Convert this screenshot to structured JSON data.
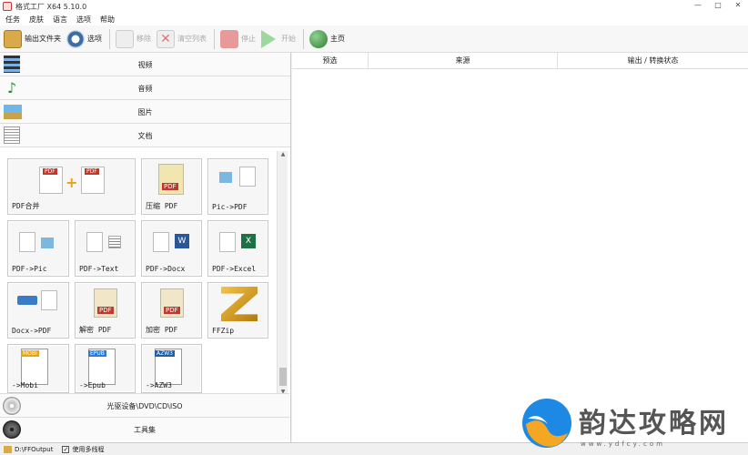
{
  "window": {
    "title": "格式工厂 X64 5.10.0",
    "controls": [
      "—",
      "□",
      "✕"
    ]
  },
  "menu": [
    "任务",
    "皮肤",
    "语言",
    "选项",
    "帮助"
  ],
  "toolbar": {
    "output_folder": "输出文件夹",
    "options": "选项",
    "remove": "移除",
    "clear_list": "清空列表",
    "stop": "停止",
    "start": "开始",
    "home": "主页"
  },
  "categories": {
    "video": "视频",
    "audio": "音频",
    "picture": "图片",
    "document": "文档"
  },
  "tools": [
    {
      "label": "PDF合并"
    },
    {
      "label": "压缩 PDF"
    },
    {
      "label": "Pic->PDF"
    },
    {
      "label": "PDF->Pic"
    },
    {
      "label": "PDF->Text"
    },
    {
      "label": "PDF->Docx"
    },
    {
      "label": "PDF->Excel"
    },
    {
      "label": "Docx->PDF"
    },
    {
      "label": "解密 PDF"
    },
    {
      "label": "加密 PDF"
    },
    {
      "label": "FFZip"
    },
    {
      "label": "->Mobi",
      "badge": "MOBI"
    },
    {
      "label": "->Epub",
      "badge": "EPUB"
    },
    {
      "label": "->AZW3",
      "badge": "AZW3"
    }
  ],
  "badges": {
    "pdf": "PDF",
    "w": "W",
    "x": "X"
  },
  "bottom_categories": {
    "disc": "光驱设备\\DVD\\CD\\ISO",
    "toolbox": "工具集"
  },
  "table": {
    "columns": [
      "预选",
      "来源",
      "输出 / 转换状态"
    ]
  },
  "status": {
    "output_path": "D:\\FFOutput",
    "multithread_check": "✓",
    "multithread": "使用多线程"
  },
  "watermark": {
    "text": "韵达攻略网",
    "url": "www.ydfcy.com"
  },
  "colors": {
    "accent": "#c0392b",
    "watermark_blue": "#1e88e5",
    "watermark_orange": "#f5a623"
  }
}
